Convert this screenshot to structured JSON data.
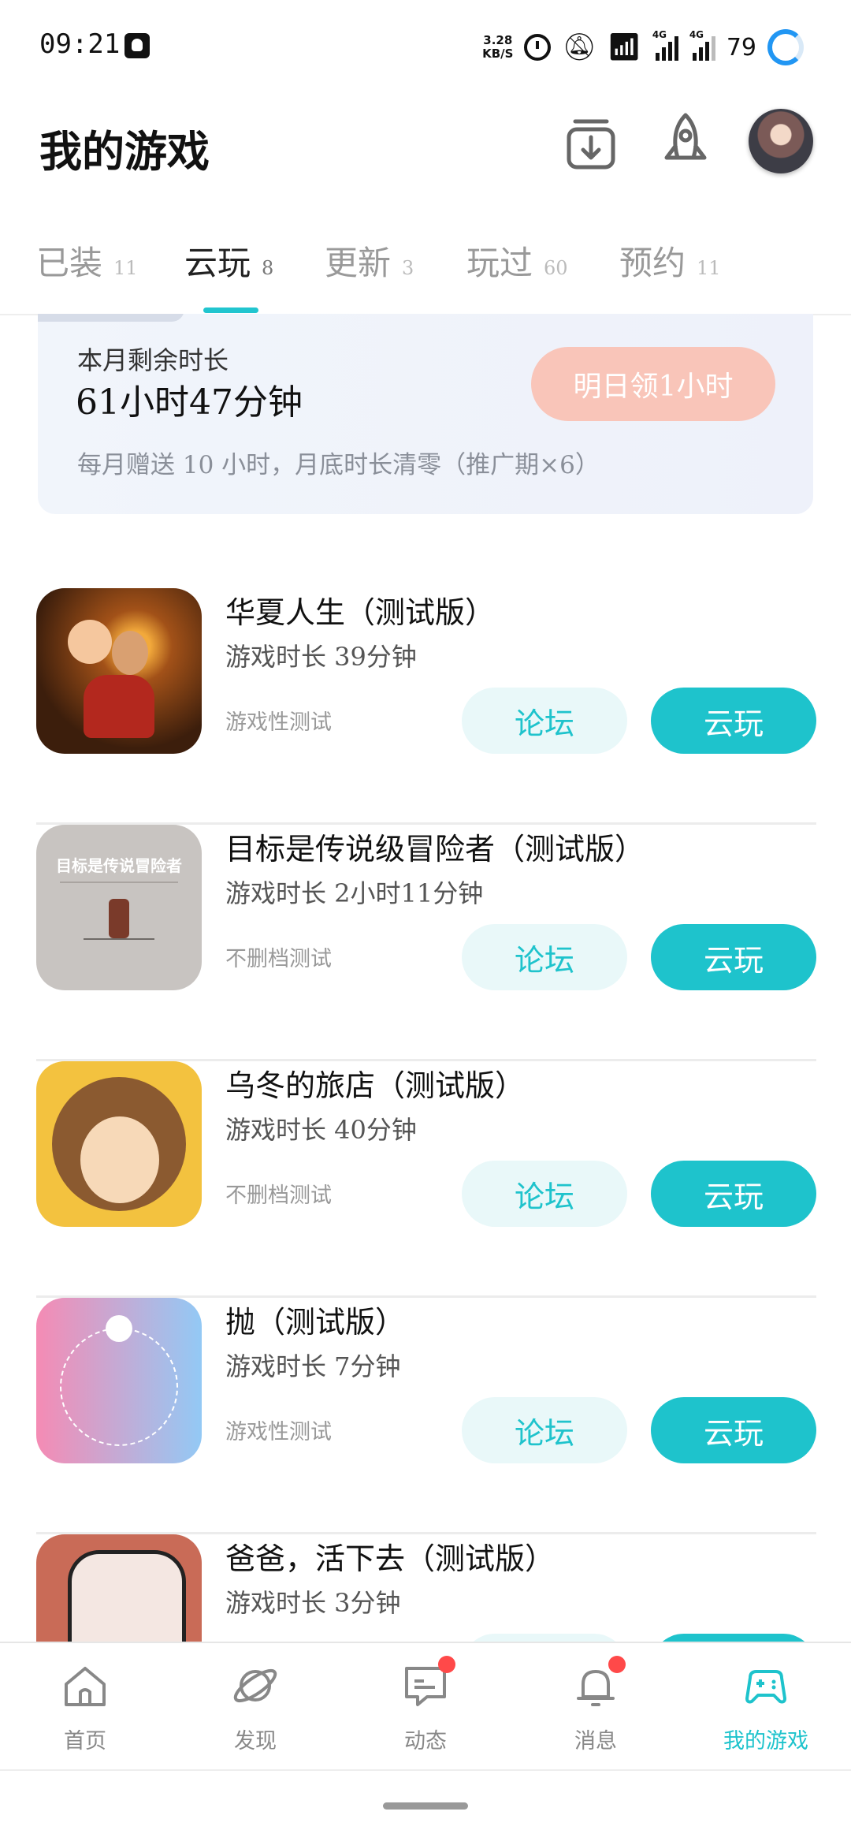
{
  "status_bar": {
    "time": "09:21",
    "net_speed_top": "3.28",
    "net_speed_bottom": "KB/S",
    "signal_tag_1": "4G",
    "signal_tag_2": "4G",
    "battery": "79"
  },
  "header": {
    "title": "我的游戏"
  },
  "tabs": [
    {
      "label": "已装",
      "count": "11"
    },
    {
      "label": "云玩",
      "count": "8"
    },
    {
      "label": "更新",
      "count": "3"
    },
    {
      "label": "玩过",
      "count": "60"
    },
    {
      "label": "预约",
      "count": "11"
    }
  ],
  "quota": {
    "label": "本月剩余时长",
    "value": "61小时47分钟",
    "claim_button": "明日领1小时",
    "note": "每月赠送 10 小时，月底时长清零（推广期×6）"
  },
  "games": [
    {
      "name": "华夏人生（测试版）",
      "time": "游戏时长 39分钟",
      "tag": "游戏性测试",
      "forum": "论坛",
      "play": "云玩"
    },
    {
      "name": "目标是传说级冒险者（测试版）",
      "time": "游戏时长 2小时11分钟",
      "tag": "不删档测试",
      "forum": "论坛",
      "play": "云玩",
      "icon_text": "目标是传说冒险者"
    },
    {
      "name": "乌冬的旅店（测试版）",
      "time": "游戏时长 40分钟",
      "tag": "不删档测试",
      "forum": "论坛",
      "play": "云玩"
    },
    {
      "name": "抛（测试版）",
      "time": "游戏时长 7分钟",
      "tag": "游戏性测试",
      "forum": "论坛",
      "play": "云玩"
    },
    {
      "name": "爸爸，活下去（测试版）",
      "time": "游戏时长 3分钟",
      "tag": "",
      "forum": "",
      "play": ""
    }
  ],
  "bottom_nav": [
    {
      "label": "首页",
      "icon": "home-icon"
    },
    {
      "label": "发现",
      "icon": "planet-icon"
    },
    {
      "label": "动态",
      "icon": "chat-icon"
    },
    {
      "label": "消息",
      "icon": "bell-icon"
    },
    {
      "label": "我的游戏",
      "icon": "gamepad-icon"
    }
  ],
  "colors": {
    "accent": "#1ec3cc",
    "claim_button": "#f9c5b9",
    "badge_red": "#ff4949"
  }
}
